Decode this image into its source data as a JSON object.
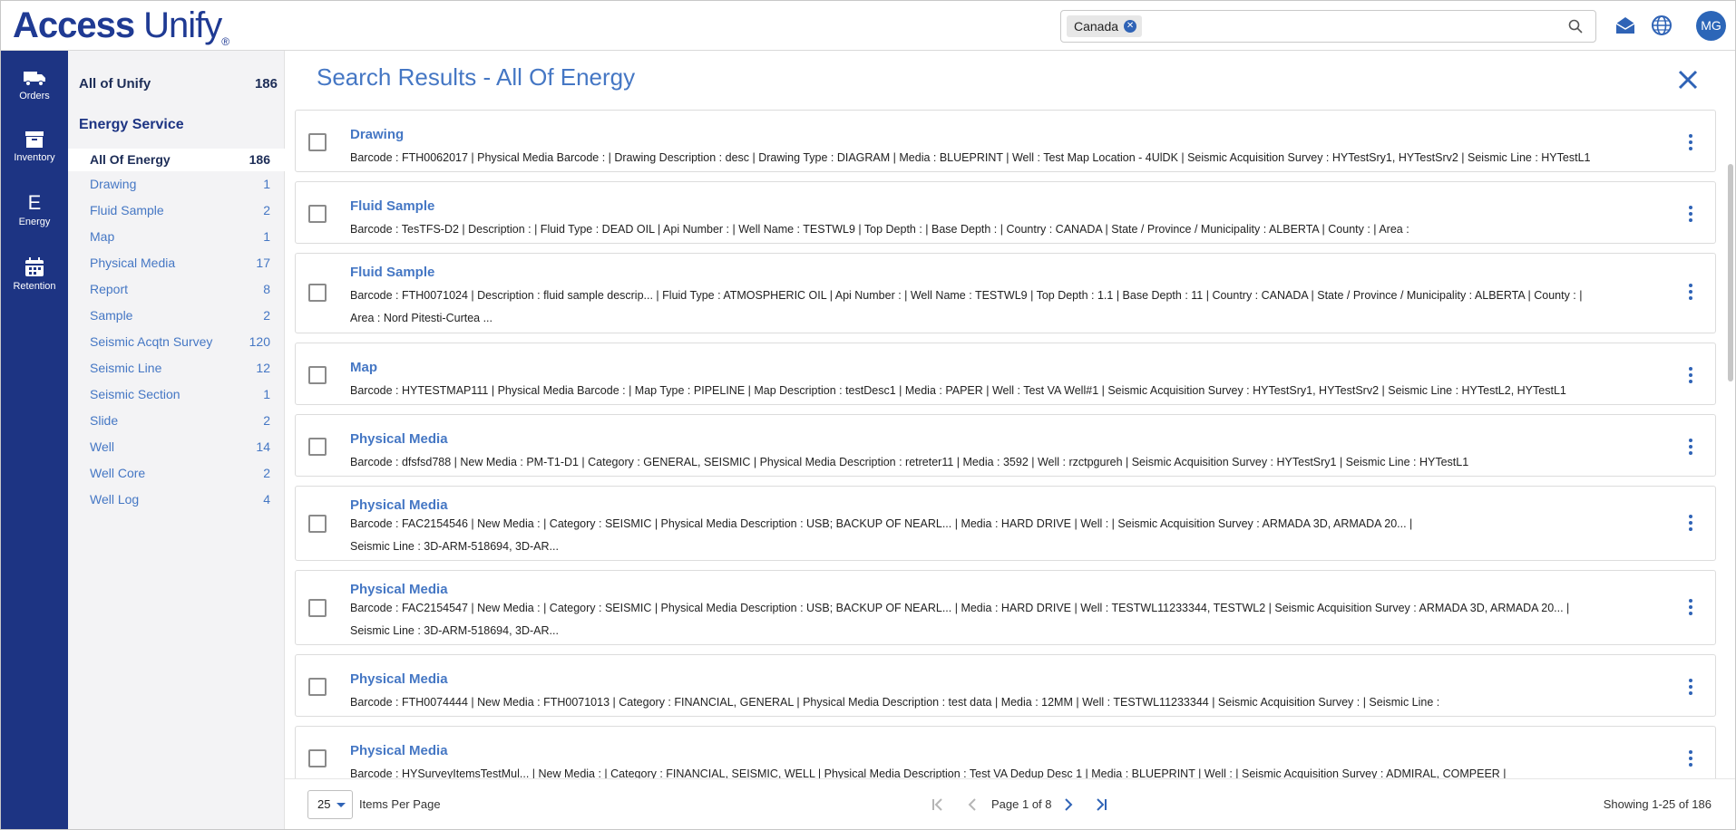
{
  "app": {
    "logo_prefix": "Access",
    "logo_suffix": "Unify",
    "logo_mark": "®"
  },
  "search": {
    "chip_label": "Canada",
    "placeholder": ""
  },
  "user": {
    "initials": "MG"
  },
  "leftnav": [
    {
      "label": "Orders",
      "icon": "truck-icon"
    },
    {
      "label": "Inventory",
      "icon": "archive-box-icon"
    },
    {
      "label": "Energy",
      "icon": "letter-e-icon",
      "letter": "E"
    },
    {
      "label": "Retention",
      "icon": "calendar-icon"
    }
  ],
  "catpanel": {
    "all_label": "All of Unify",
    "all_count": "186",
    "heading": "Energy Service",
    "items": [
      {
        "label": "All Of Energy",
        "count": "186"
      },
      {
        "label": "Drawing",
        "count": "1"
      },
      {
        "label": "Fluid Sample",
        "count": "2"
      },
      {
        "label": "Map",
        "count": "1"
      },
      {
        "label": "Physical Media",
        "count": "17"
      },
      {
        "label": "Report",
        "count": "8"
      },
      {
        "label": "Sample",
        "count": "2"
      },
      {
        "label": "Seismic Acqtn Survey",
        "count": "120"
      },
      {
        "label": "Seismic Line",
        "count": "12"
      },
      {
        "label": "Seismic Section",
        "count": "1"
      },
      {
        "label": "Slide",
        "count": "2"
      },
      {
        "label": "Well",
        "count": "14"
      },
      {
        "label": "Well Core",
        "count": "2"
      },
      {
        "label": "Well Log",
        "count": "4"
      }
    ]
  },
  "main": {
    "title": "Search Results - All Of Energy",
    "results": [
      {
        "title": "Drawing",
        "lines": [
          "Barcode : FTH0062017 |  Physical Media Barcode : |  Drawing Description : desc |  Drawing Type : DIAGRAM |  Media : BLUEPRINT |  Well : Test Map Location - 4UlDK |  Seismic Acquisition Survey : HYTestSry1, HYTestSrv2 |  Seismic Line : HYTestL1"
        ]
      },
      {
        "title": "Fluid Sample",
        "lines": [
          "Barcode : TesTFS-D2 |  Description : |  Fluid Type : DEAD OIL |  Api Number : |  Well Name : TESTWL9 |  Top Depth : |  Base Depth : |  Country : CANADA |  State / Province / Municipality : ALBERTA |  County : |  Area :"
        ]
      },
      {
        "title": "Fluid Sample",
        "lines": [
          "Barcode : FTH0071024 |  Description : fluid sample descrip... |  Fluid Type : ATMOSPHERIC OIL |  Api Number : |  Well Name : TESTWL9 |  Top Depth : 1.1 |  Base Depth : 11 |  Country : CANADA |  State / Province / Municipality : ALBERTA |  County : |",
          "Area : Nord Pitesti-Curtea ..."
        ]
      },
      {
        "title": "Map",
        "lines": [
          "Barcode : HYTESTMAP111 |  Physical Media Barcode : |  Map Type : PIPELINE |  Map Description : testDesc1 |  Media : PAPER |  Well : Test VA Well#1 |  Seismic Acquisition Survey : HYTestSry1, HYTestSrv2 |  Seismic Line : HYTestL2, HYTestL1"
        ]
      },
      {
        "title": "Physical Media",
        "lines": [
          "Barcode : dfsfsd788 |  New Media : PM-T1-D1 |  Category : GENERAL, SEISMIC |  Physical Media Description : retreter11 |  Media : 3592 |  Well : rzctpgureh |  Seismic Acquisition Survey : HYTestSry1 |  Seismic Line : HYTestL1"
        ]
      },
      {
        "title": "Physical Media",
        "lines": [
          "Barcode : FAC2154546 |  New Media : |  Category : SEISMIC |  Physical Media Description : USB; BACKUP OF NEARL... |  Media : HARD DRIVE |  Well : |  Seismic Acquisition Survey : ARMADA 3D, ARMADA 20... |",
          "Seismic Line : 3D-ARM-518694, 3D-AR..."
        ]
      },
      {
        "title": "Physical Media",
        "lines": [
          "Barcode : FAC2154547 |  New Media : |  Category : SEISMIC |  Physical Media Description : USB; BACKUP OF NEARL... |  Media : HARD DRIVE |  Well : TESTWL11233344, TESTWL2 |  Seismic Acquisition Survey : ARMADA 3D, ARMADA 20... |",
          "Seismic Line : 3D-ARM-518694, 3D-AR..."
        ]
      },
      {
        "title": "Physical Media",
        "lines": [
          "Barcode : FTH0074444 |  New Media : FTH0071013 |  Category : FINANCIAL, GENERAL |  Physical Media Description : test data |  Media : 12MM |  Well : TESTWL11233344 |  Seismic Acquisition Survey : |  Seismic Line :"
        ]
      },
      {
        "title": "Physical Media",
        "lines": [
          "Barcode : HYSurveyItemsTestMul... |  New Media : |  Category : FINANCIAL, SEISMIC, WELL |  Physical Media Description : Test VA Dedup Desc 1 |  Media : BLUEPRINT |  Well : |  Seismic Acquisition Survey : ADMIRAL, COMPEER |"
        ]
      }
    ]
  },
  "pager": {
    "per_page": "25",
    "per_page_label": "Items Per Page",
    "page_text": "Page 1 of 8",
    "showing": "Showing 1-25 of 186"
  }
}
